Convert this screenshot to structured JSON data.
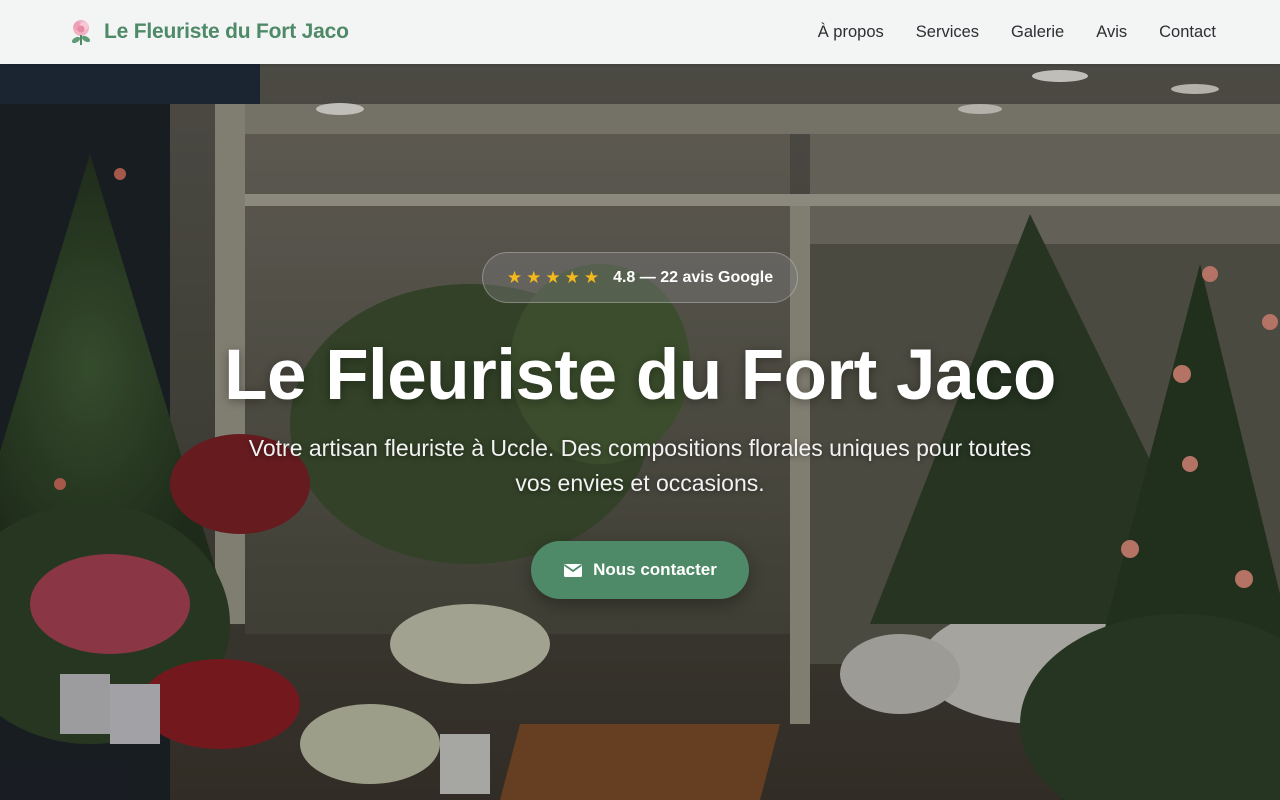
{
  "brand": {
    "name": "Le Fleuriste du Fort Jaco",
    "icon": "rose-icon"
  },
  "nav": {
    "items": [
      {
        "label": "À propos"
      },
      {
        "label": "Services"
      },
      {
        "label": "Galerie"
      },
      {
        "label": "Avis"
      },
      {
        "label": "Contact"
      }
    ]
  },
  "hero": {
    "rating": {
      "stars": 5,
      "text": "4.8 — 22 avis Google",
      "star_icon": "star-icon"
    },
    "title": "Le Fleuriste du Fort Jaco",
    "subtitle": "Votre artisan fleuriste à Uccle. Des compositions florales uniques pour toutes vos envies et occasions.",
    "cta": {
      "label": "Nous contacter",
      "icon": "envelope-icon"
    },
    "background": "flower-shop-storefront-photo"
  },
  "colors": {
    "accent": "#4f8a68",
    "star": "#f3b81c",
    "header_bg": "#f3f4f4"
  }
}
